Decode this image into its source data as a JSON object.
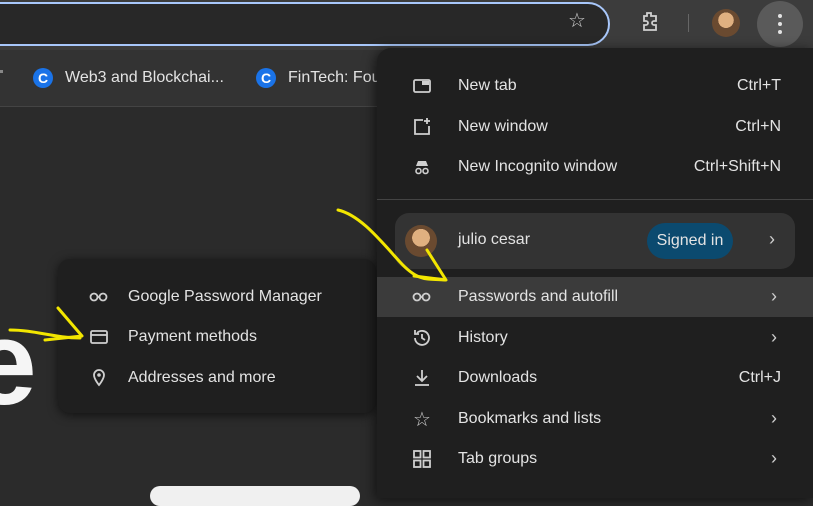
{
  "browser": {
    "bookmarks": [
      {
        "label": "Web3 and Blockchai...",
        "favicon": "C"
      },
      {
        "label": "FinTech: Fou",
        "favicon": "C"
      }
    ],
    "accent": "#a8c7fa"
  },
  "menu": {
    "items_top": [
      {
        "label": "New tab",
        "shortcut": "Ctrl+T",
        "icon": "new-tab-icon"
      },
      {
        "label": "New window",
        "shortcut": "Ctrl+N",
        "icon": "new-window-icon"
      },
      {
        "label": "New Incognito window",
        "shortcut": "Ctrl+Shift+N",
        "icon": "incognito-icon"
      }
    ],
    "profile": {
      "name": "julio cesar",
      "status": "Signed in"
    },
    "items_bottom": [
      {
        "label": "Passwords and autofill",
        "icon": "key-icon",
        "has_submenu": true
      },
      {
        "label": "History",
        "icon": "history-icon",
        "has_submenu": true
      },
      {
        "label": "Downloads",
        "shortcut": "Ctrl+J",
        "icon": "download-icon"
      },
      {
        "label": "Bookmarks and lists",
        "icon": "star-icon",
        "has_submenu": true
      },
      {
        "label": "Tab groups",
        "icon": "grid-icon",
        "has_submenu": true
      }
    ]
  },
  "submenu": {
    "items": [
      {
        "label": "Google Password Manager",
        "icon": "key-icon"
      },
      {
        "label": "Payment methods",
        "icon": "card-icon"
      },
      {
        "label": "Addresses and more",
        "icon": "location-pin-icon"
      }
    ]
  },
  "page": {
    "big_letter": "e"
  }
}
